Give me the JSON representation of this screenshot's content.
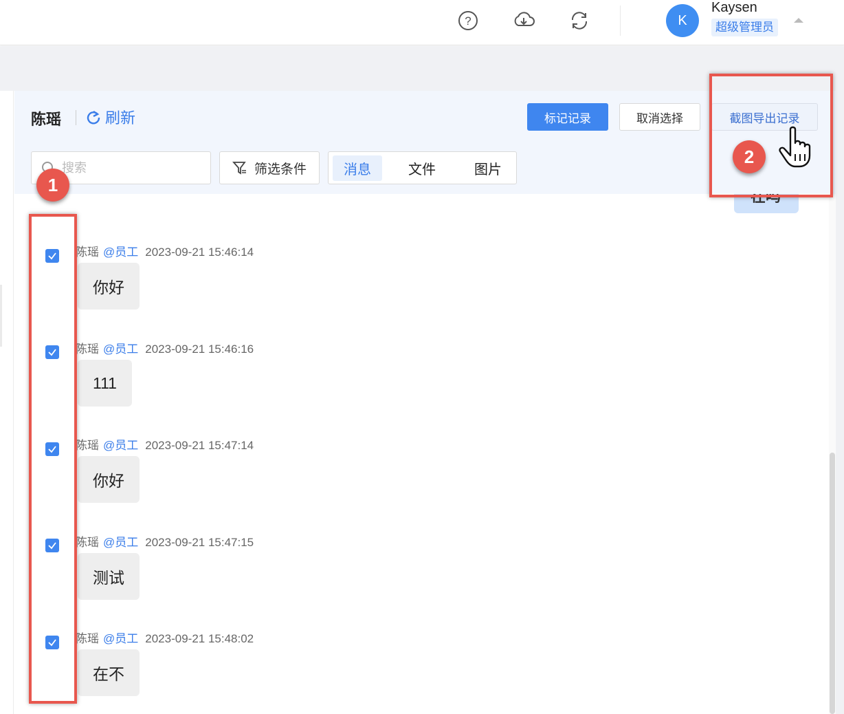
{
  "topbar": {
    "icons": [
      "help-icon",
      "cloud-download-icon",
      "sync-icon"
    ],
    "user": {
      "avatar_letter": "K",
      "name": "Kaysen",
      "role": "超级管理员"
    }
  },
  "chat_header": {
    "contact_name": "陈瑶",
    "refresh_label": "刷新"
  },
  "actions": {
    "mark_label": "标记记录",
    "cancel_label": "取消选择",
    "export_label": "截图导出记录"
  },
  "search": {
    "placeholder": "搜索",
    "value": ""
  },
  "filter": {
    "label": "筛选条件"
  },
  "tabs": [
    {
      "label": "消息",
      "active": true
    },
    {
      "label": "文件",
      "active": false
    },
    {
      "label": "图片",
      "active": false
    }
  ],
  "messages": [
    {
      "sender": "陈瑶",
      "role": "@员工",
      "time": "2023-09-21 15:46:14",
      "text": "你好",
      "checked": true
    },
    {
      "sender": "陈瑶",
      "role": "@员工",
      "time": "2023-09-21 15:46:16",
      "text": "111",
      "checked": true
    },
    {
      "sender": "陈瑶",
      "role": "@员工",
      "time": "2023-09-21 15:47:14",
      "text": "你好",
      "checked": true
    },
    {
      "sender": "陈瑶",
      "role": "@员工",
      "time": "2023-09-21 15:47:15",
      "text": "测试",
      "checked": true
    },
    {
      "sender": "陈瑶",
      "role": "@员工",
      "time": "2023-09-21 15:48:02",
      "text": "在不",
      "checked": true
    }
  ],
  "annotations": [
    {
      "label": "1"
    },
    {
      "label": "2"
    }
  ],
  "colors": {
    "primary": "#3f86ef",
    "annotation": "#e8574e",
    "panel_bg": "#f2f6fd"
  }
}
